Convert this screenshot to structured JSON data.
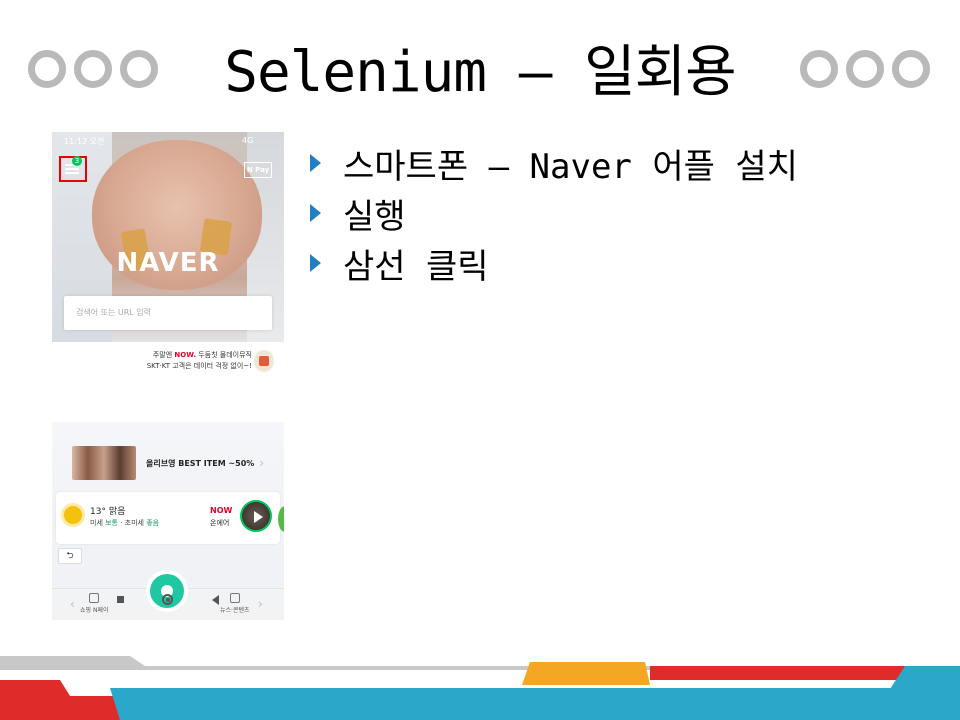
{
  "slide": {
    "title": "Selenium – 일회용",
    "bullets": [
      "스마트폰 – Naver 어플 설치",
      "실행",
      "삼선 클릭"
    ],
    "colors": {
      "bullet_arrow": "#1f7fbf",
      "circles": "#b9b9b9",
      "stripe_red": "#e02b2b",
      "stripe_teal": "#2aa7c9",
      "stripe_orange": "#f5a623",
      "stripe_gray": "#c8c8c8"
    }
  },
  "phone": {
    "status_time": "11:12 오전",
    "status_network": "4G",
    "menu_badge": "3",
    "npay_label": "N Pay",
    "logo": "NAVER",
    "search_placeholder": "검색어 또는 URL 입력",
    "promo": {
      "line1_prefix": "주말엔 ",
      "line1_brand": "NOW.",
      "line1_suffix": " 두둠칫 몰데이뮤직",
      "line2": "SKT·KT 고객은 데이터 걱정 없이~!"
    },
    "shopping_banner": "올리브영 BEST ITEM ~50%",
    "weather": {
      "temp": "13° 맑음",
      "dust_prefix": "미세 ",
      "dust_normal": "보통",
      "dust_middle": " · 초미세 ",
      "dust_good": "좋음"
    },
    "now": {
      "logo": "NOW",
      "sub": "온에어"
    },
    "tabs": {
      "left": "쇼핑 N페이",
      "right": "뉴스·콘텐츠"
    },
    "icons": [
      "hamburger-menu-icon",
      "npay-icon",
      "sun-icon",
      "play-icon",
      "refresh-icon",
      "green-dot-button-icon"
    ]
  },
  "android_nav": [
    "recent-apps-icon",
    "home-icon",
    "back-icon"
  ]
}
